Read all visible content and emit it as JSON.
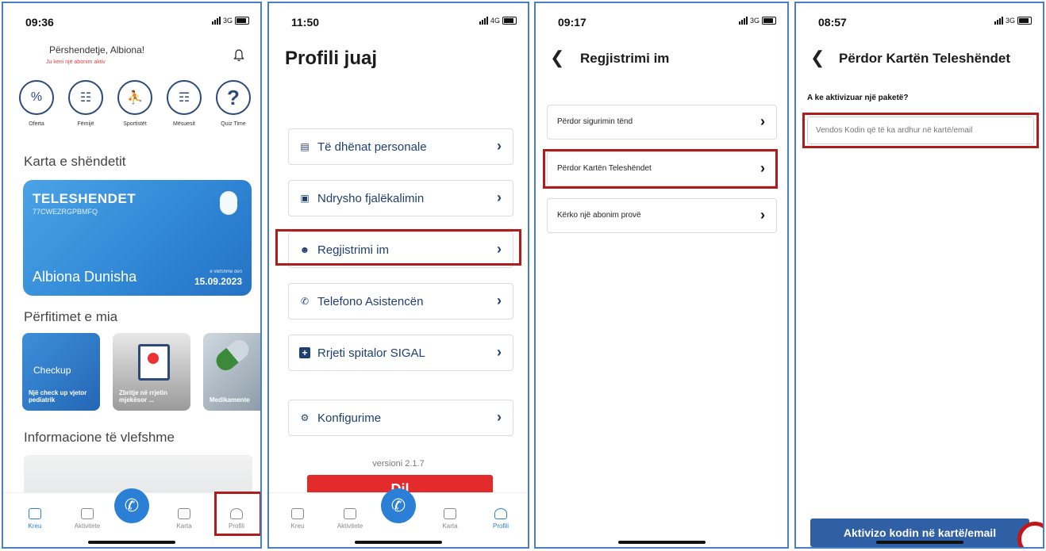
{
  "panel1": {
    "time": "09:36",
    "network": "3G",
    "greeting": "Përshendetje, Albiona!",
    "greeting_sub": "Ju keni një abonim aktiv",
    "categories": [
      "Oferta",
      "Fëmijë",
      "Sportistët",
      "Mësuesit",
      "Quiz Time"
    ],
    "card_section_title": "Karta e shëndetit",
    "card": {
      "brand": "TELESHENDET",
      "code": "77CWEZRGPBMFQ",
      "holder": "Albiona Dunisha",
      "valid_label": "e vlefshme deri",
      "valid_date": "15.09.2023"
    },
    "benefits_title": "Përfitimet e mia",
    "benefits": [
      {
        "label": "Një check up vjetor pediatrik",
        "badge": "Checkup"
      },
      {
        "label": "Zbritje në rrjetin mjekësor ..."
      },
      {
        "label": "Medikamente"
      }
    ],
    "info_title": "Informacione të vlefshme",
    "tabs": [
      "Kreu",
      "Aktivitete",
      "Karta",
      "Profili"
    ]
  },
  "panel2": {
    "time": "11:50",
    "network": "4G",
    "title": "Profili juaj",
    "items": [
      "Të dhënat personale",
      "Ndrysho fjalëkalimin",
      "Regjistrimi im",
      "Telefono Asistencën",
      "Rrjeti spitalor SIGAL",
      "Konfigurime"
    ],
    "version": "versioni  2.1.7",
    "logout": "Dil",
    "tabs": [
      "Kreu",
      "Aktivitete",
      "Karta",
      "Profili"
    ]
  },
  "panel3": {
    "time": "09:17",
    "network": "3G",
    "title": "Regjistrimi im",
    "items": [
      "Përdor sigurimin tënd",
      "Përdor Kartën Teleshëndet",
      "Kërko një abonim provë"
    ]
  },
  "panel4": {
    "time": "08:57",
    "network": "3G",
    "title": "Përdor Kartën Teleshëndet",
    "question": "A ke aktivizuar një paketë?",
    "input_placeholder": "Vendos Kodin që të ka ardhur në kartë/email",
    "button": "Aktivizo kodin në kartë/email"
  },
  "colors": {
    "accent": "#2b7fd4",
    "highlight": "#b01c1c",
    "panel_border": "#4a7ec7",
    "logout": "#e42b2b",
    "primary_button": "#2f5fa5"
  }
}
